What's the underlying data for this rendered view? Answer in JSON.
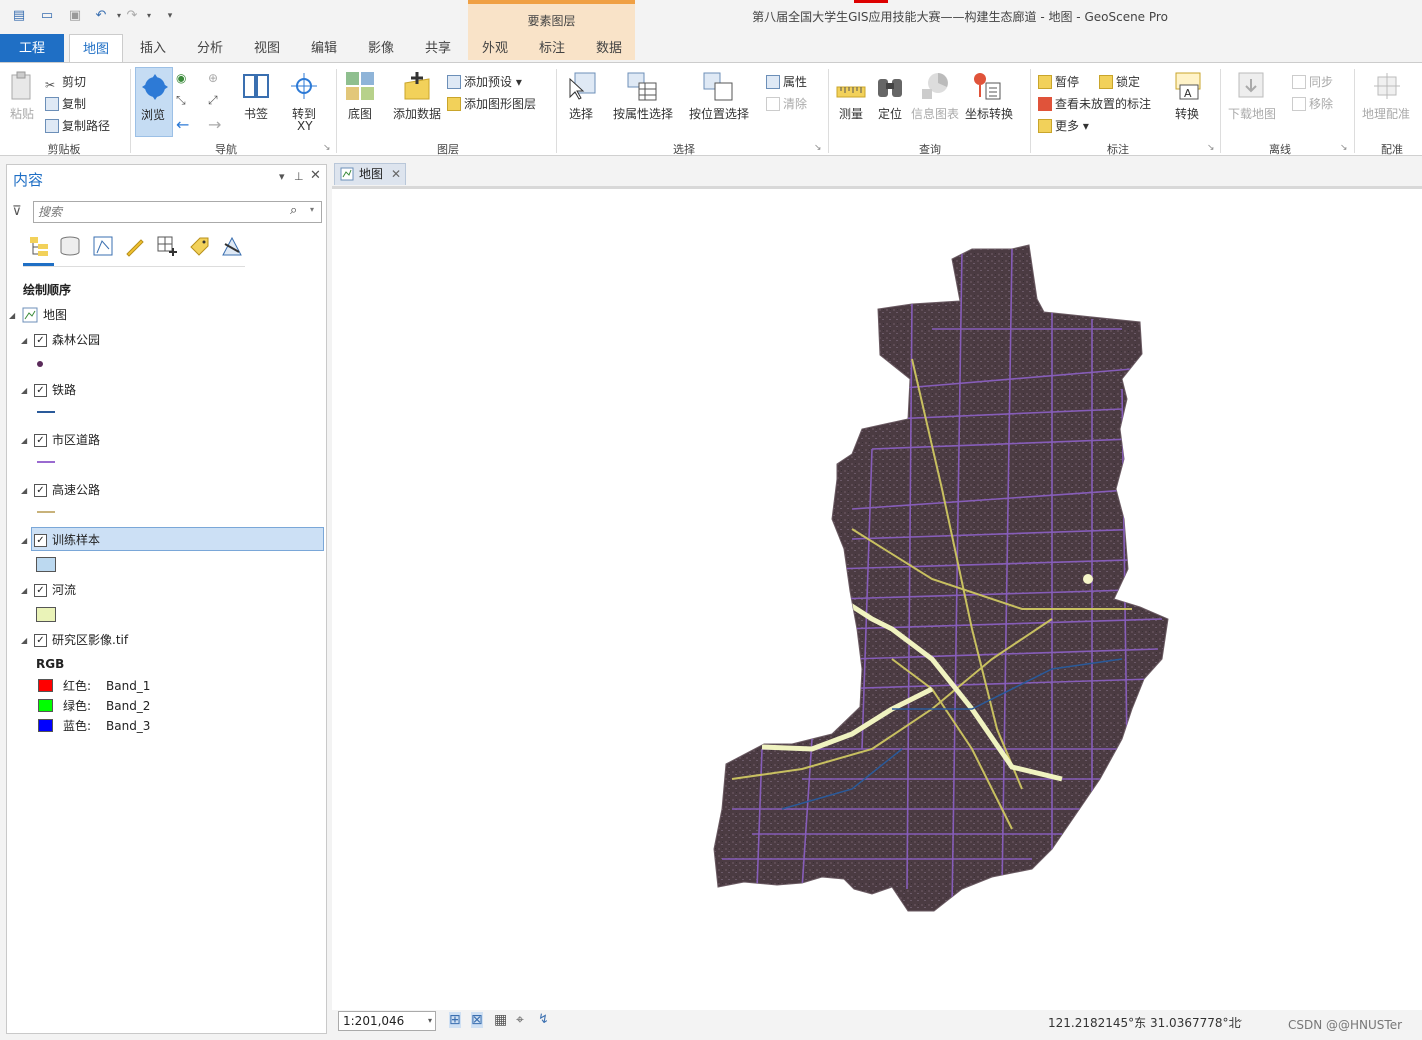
{
  "title_bar": {
    "app_title": "第八届全国大学生GIS应用技能大赛——构建生态廊道 - 地图 - GeoScene Pro",
    "context_group": "要素图层"
  },
  "ribbon_tabs": [
    "工程",
    "地图",
    "插入",
    "分析",
    "视图",
    "编辑",
    "影像",
    "共享",
    "外观",
    "标注",
    "数据"
  ],
  "ribbon": {
    "clipboard": {
      "label": "剪贴板",
      "paste": "粘贴",
      "cut": "剪切",
      "copy": "复制",
      "copy_path": "复制路径"
    },
    "navigate": {
      "label": "导航",
      "explore": "浏览",
      "bookmarks": "书签",
      "goto": "转到",
      "goto_sub": "XY"
    },
    "layer": {
      "label": "图层",
      "basemap": "底图",
      "add_data": "添加数据",
      "add_preset": "添加预设",
      "add_graphics": "添加图形图层"
    },
    "selection": {
      "label": "选择",
      "select": "选择",
      "by_attr": "按属性选择",
      "by_loc": "按位置选择",
      "attributes": "属性",
      "clear": "清除"
    },
    "inquiry": {
      "label": "查询",
      "measure": "测量",
      "locate": "定位",
      "infographics": "信息图表",
      "convert_coords": "坐标转换"
    },
    "labeling": {
      "label": "标注",
      "pause": "暂停",
      "lock": "锁定",
      "view_unplaced": "查看未放置的标注",
      "more": "更多",
      "convert": "转换"
    },
    "offline": {
      "label": "离线",
      "download": "下载地图",
      "sync": "同步",
      "remove": "移除"
    },
    "georef": {
      "label": "配准",
      "georeference": "地理配准"
    }
  },
  "contents": {
    "title": "内容",
    "search_placeholder": "搜索",
    "drawing_order": "绘制顺序",
    "map_name": "地图",
    "layers": [
      {
        "name": "森林公园",
        "checked": true
      },
      {
        "name": "铁路",
        "checked": true
      },
      {
        "name": "市区道路",
        "checked": true
      },
      {
        "name": "高速公路",
        "checked": true
      },
      {
        "name": "训练样本",
        "checked": true,
        "selected": true
      },
      {
        "name": "河流",
        "checked": true
      },
      {
        "name": "研究区影像.tif",
        "checked": true
      }
    ],
    "rgb_label": "RGB",
    "bands": [
      {
        "channel": "红色:",
        "band": "Band_1",
        "color": "#ff0000"
      },
      {
        "channel": "绿色:",
        "band": "Band_2",
        "color": "#00ff00"
      },
      {
        "channel": "蓝色:",
        "band": "Band_3",
        "color": "#0000ff"
      }
    ]
  },
  "map_view": {
    "tab_label": "地图",
    "scale": "1:201,046",
    "coordinates": "121.2182145°东 31.0367778°北",
    "watermark": "CSDN @@HNUSTer"
  },
  "colors": {
    "accent": "#1f6fc5",
    "context_tab": "#f9e3c8",
    "imagery_base": "#4a3a40",
    "roads": "#8a5fc0",
    "highway": "#c8c060",
    "river": "#f0f3c0"
  }
}
